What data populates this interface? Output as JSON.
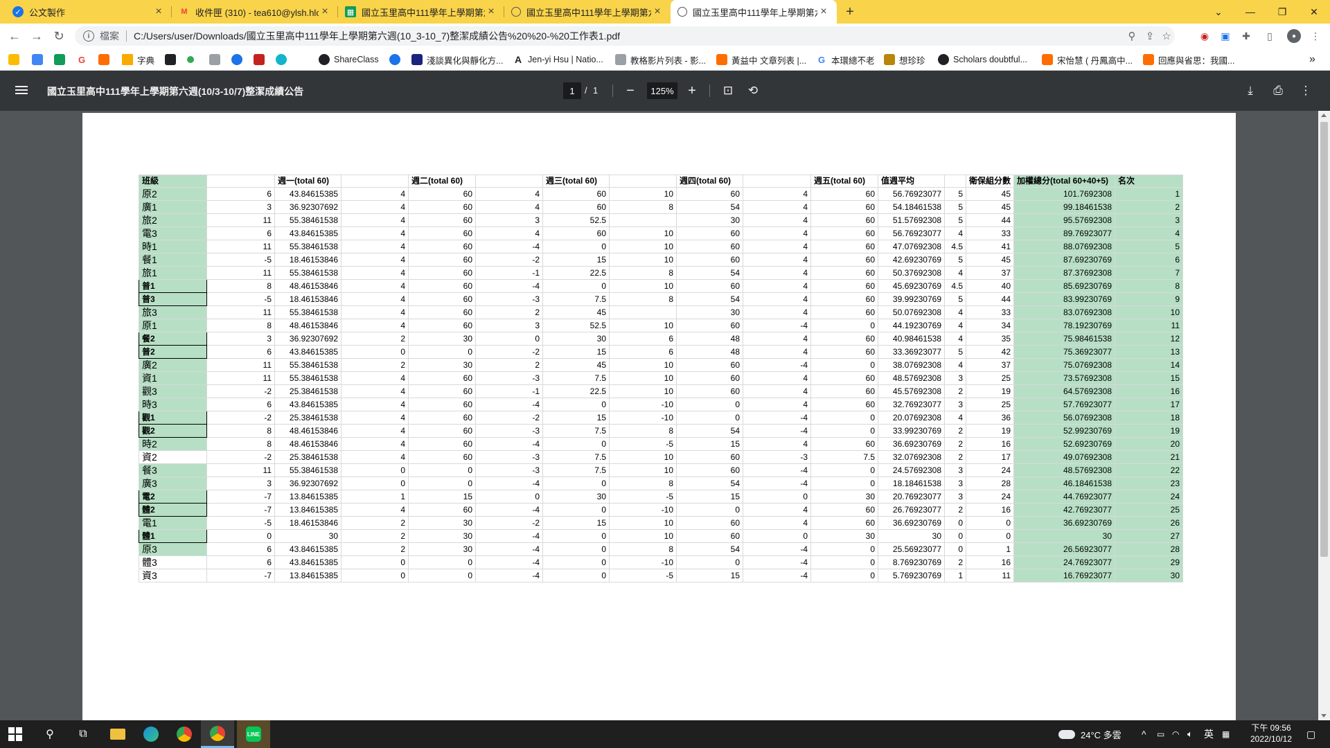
{
  "browser": {
    "tabs": [
      {
        "title": "公文製作",
        "icon": "gov-icon",
        "active": false
      },
      {
        "title": "收件匣 (310) - tea610@ylsh.hlc",
        "icon": "gmail-icon",
        "active": false
      },
      {
        "title": "國立玉里高中111學年上學期第六",
        "icon": "sheets-icon",
        "active": false
      },
      {
        "title": "國立玉里高中111學年上學期第六",
        "icon": "globe-icon",
        "active": false
      },
      {
        "title": "國立玉里高中111學年上學期第六",
        "icon": "globe-icon",
        "active": true
      }
    ],
    "new_tab": "+",
    "window_controls": {
      "menu": "⌄",
      "minimize": "—",
      "restore": "❐",
      "close": "✕"
    },
    "address": {
      "scheme_label": "檔案",
      "url": "C:/Users/user/Downloads/國立玉里高中111學年上學期第六週(10_3-10_7)整潔成績公告%20%20-%20工作表1.pdf"
    },
    "bookmarks": [
      {
        "label": "",
        "icon": "drive-icon",
        "color": "#fbbc04"
      },
      {
        "label": "",
        "icon": "bookmark-icon-2",
        "color": "#4285f4"
      },
      {
        "label": "",
        "icon": "bookmark-icon-3",
        "color": "#0f9d58"
      },
      {
        "label": "",
        "icon": "google-icon",
        "color": "#ea4335"
      },
      {
        "label": "",
        "icon": "bookmark-icon-5",
        "color": "#ff6d00"
      },
      {
        "label": "字典",
        "icon": "folder-icon",
        "color": "#f9ab00"
      },
      {
        "label": "",
        "icon": "bookmark-icon-7",
        "color": "#202124"
      },
      {
        "label": "",
        "icon": "bookmark-icon-8",
        "color": "#34a853"
      },
      {
        "label": "",
        "icon": "bookmark-icon-9",
        "color": "#9aa0a6"
      },
      {
        "label": "",
        "icon": "bookmark-icon-10",
        "color": "#1a73e8"
      },
      {
        "label": "",
        "icon": "bookmark-icon-11",
        "color": "#c5221f"
      },
      {
        "label": "",
        "icon": "bookmark-icon-12",
        "color": "#12b5cb"
      },
      {
        "label": "ShareClass",
        "icon": "shareclass-icon",
        "color": "#202124"
      },
      {
        "label": "",
        "icon": "bookmark-icon-14",
        "color": "#1a73e8"
      },
      {
        "label": "淺談異化與靜化方...",
        "icon": "bookmark-icon-15",
        "color": "#1a237e"
      },
      {
        "label": "Jen-yi Hsu | Natio...",
        "icon": "academia-icon",
        "color": "#202124"
      },
      {
        "label": "教格影片列表 - 影...",
        "icon": "bookmark-icon-17",
        "color": "#5f6368"
      },
      {
        "label": "黃益中 文章列表 |...",
        "icon": "bookmark-icon-18",
        "color": "#ff6d00"
      },
      {
        "label": "本環總不老",
        "icon": "google-icon",
        "color": "#4285f4"
      },
      {
        "label": "想珍珍",
        "icon": "bookmark-icon-20",
        "color": "#b8860b"
      },
      {
        "label": "Scholars doubtful...",
        "icon": "bookmark-icon-21",
        "color": "#202124"
      },
      {
        "label": "宋怡慧 ( 丹鳳高中...",
        "icon": "bookmark-icon-22",
        "color": "#ff6d00"
      },
      {
        "label": "回應與省思：我國...",
        "icon": "bookmark-icon-23",
        "color": "#ff6d00"
      }
    ],
    "more_bookmarks": "»"
  },
  "pdf": {
    "title": "國立玉里高中111學年上學期第六週(10/3-10/7)整潔成績公告",
    "page_current": "1",
    "page_sep": "/",
    "page_total": "1",
    "zoom": "125%",
    "zoom_out": "−",
    "zoom_in": "+"
  },
  "table": {
    "headers": [
      "班級",
      "",
      "週一(total 60)",
      "",
      "週二(total 60)",
      "",
      "週三(total 60)",
      "",
      "週四(total 60)",
      "",
      "週五(total 60)",
      "值週平均",
      "",
      "衛保組分數",
      "加權總分(total 60+40+5)",
      "名次"
    ],
    "rows": [
      {
        "cls": "原2",
        "style": "",
        "v": [
          "6",
          "43.84615385",
          "4",
          "60",
          "4",
          "60",
          "10",
          "60",
          "4",
          "60",
          "56.76923077",
          "5",
          "45",
          "101.7692308",
          "1"
        ]
      },
      {
        "cls": "廣1",
        "style": "",
        "v": [
          "3",
          "36.92307692",
          "4",
          "60",
          "4",
          "60",
          "8",
          "54",
          "4",
          "60",
          "54.18461538",
          "5",
          "45",
          "99.18461538",
          "2"
        ]
      },
      {
        "cls": "旅2",
        "style": "",
        "v": [
          "11",
          "55.38461538",
          "4",
          "60",
          "3",
          "52.5",
          "",
          "30",
          "4",
          "60",
          "51.57692308",
          "5",
          "44",
          "95.57692308",
          "3"
        ]
      },
      {
        "cls": "電3",
        "style": "",
        "v": [
          "6",
          "43.84615385",
          "4",
          "60",
          "4",
          "60",
          "10",
          "60",
          "4",
          "60",
          "56.76923077",
          "4",
          "33",
          "89.76923077",
          "4"
        ]
      },
      {
        "cls": "時1",
        "style": "",
        "v": [
          "11",
          "55.38461538",
          "4",
          "60",
          "-4",
          "0",
          "10",
          "60",
          "4",
          "60",
          "47.07692308",
          "4.5",
          "41",
          "88.07692308",
          "5"
        ]
      },
      {
        "cls": "餐1",
        "style": "",
        "v": [
          "-5",
          "18.46153846",
          "4",
          "60",
          "-2",
          "15",
          "10",
          "60",
          "4",
          "60",
          "42.69230769",
          "5",
          "45",
          "87.69230769",
          "6"
        ]
      },
      {
        "cls": "旅1",
        "style": "",
        "v": [
          "11",
          "55.38461538",
          "4",
          "60",
          "-1",
          "22.5",
          "8",
          "54",
          "4",
          "60",
          "50.37692308",
          "4",
          "37",
          "87.37692308",
          "7"
        ]
      },
      {
        "cls": "普1",
        "style": "boxed",
        "v": [
          "8",
          "48.46153846",
          "4",
          "60",
          "-4",
          "0",
          "10",
          "60",
          "4",
          "60",
          "45.69230769",
          "4.5",
          "40",
          "85.69230769",
          "8"
        ]
      },
      {
        "cls": "普3",
        "style": "boxed",
        "v": [
          "-5",
          "18.46153846",
          "4",
          "60",
          "-3",
          "7.5",
          "8",
          "54",
          "4",
          "60",
          "39.99230769",
          "5",
          "44",
          "83.99230769",
          "9"
        ]
      },
      {
        "cls": "旅3",
        "style": "",
        "v": [
          "11",
          "55.38461538",
          "4",
          "60",
          "2",
          "45",
          "",
          "30",
          "4",
          "60",
          "50.07692308",
          "4",
          "33",
          "83.07692308",
          "10"
        ]
      },
      {
        "cls": "原1",
        "style": "",
        "v": [
          "8",
          "48.46153846",
          "4",
          "60",
          "3",
          "52.5",
          "10",
          "60",
          "-4",
          "0",
          "44.19230769",
          "4",
          "34",
          "78.19230769",
          "11"
        ]
      },
      {
        "cls": "餐2",
        "style": "boxed",
        "v": [
          "3",
          "36.92307692",
          "2",
          "30",
          "0",
          "30",
          "6",
          "48",
          "4",
          "60",
          "40.98461538",
          "4",
          "35",
          "75.98461538",
          "12"
        ]
      },
      {
        "cls": "普2",
        "style": "boxed",
        "v": [
          "6",
          "43.84615385",
          "0",
          "0",
          "-2",
          "15",
          "6",
          "48",
          "4",
          "60",
          "33.36923077",
          "5",
          "42",
          "75.36923077",
          "13"
        ]
      },
      {
        "cls": "廣2",
        "style": "",
        "v": [
          "11",
          "55.38461538",
          "2",
          "30",
          "2",
          "45",
          "10",
          "60",
          "-4",
          "0",
          "38.07692308",
          "4",
          "37",
          "75.07692308",
          "14"
        ]
      },
      {
        "cls": "資1",
        "style": "",
        "v": [
          "11",
          "55.38461538",
          "4",
          "60",
          "-3",
          "7.5",
          "10",
          "60",
          "4",
          "60",
          "48.57692308",
          "3",
          "25",
          "73.57692308",
          "15"
        ]
      },
      {
        "cls": "觀3",
        "style": "",
        "v": [
          "-2",
          "25.38461538",
          "4",
          "60",
          "-1",
          "22.5",
          "10",
          "60",
          "4",
          "60",
          "45.57692308",
          "2",
          "19",
          "64.57692308",
          "16"
        ]
      },
      {
        "cls": "時3",
        "style": "",
        "v": [
          "6",
          "43.84615385",
          "4",
          "60",
          "-4",
          "0",
          "-10",
          "0",
          "4",
          "60",
          "32.76923077",
          "3",
          "25",
          "57.76923077",
          "17"
        ]
      },
      {
        "cls": "觀1",
        "style": "boxed",
        "v": [
          "-2",
          "25.38461538",
          "4",
          "60",
          "-2",
          "15",
          "-10",
          "0",
          "-4",
          "0",
          "20.07692308",
          "4",
          "36",
          "56.07692308",
          "18"
        ]
      },
      {
        "cls": "觀2",
        "style": "boxed",
        "v": [
          "8",
          "48.46153846",
          "4",
          "60",
          "-3",
          "7.5",
          "8",
          "54",
          "-4",
          "0",
          "33.99230769",
          "2",
          "19",
          "52.99230769",
          "19"
        ]
      },
      {
        "cls": "時2",
        "style": "",
        "v": [
          "8",
          "48.46153846",
          "4",
          "60",
          "-4",
          "0",
          "-5",
          "15",
          "4",
          "60",
          "36.69230769",
          "2",
          "16",
          "52.69230769",
          "20"
        ]
      },
      {
        "cls": "資2",
        "style": "plain",
        "v": [
          "-2",
          "25.38461538",
          "4",
          "60",
          "-3",
          "7.5",
          "10",
          "60",
          "-3",
          "7.5",
          "32.07692308",
          "2",
          "17",
          "49.07692308",
          "21"
        ]
      },
      {
        "cls": "餐3",
        "style": "",
        "v": [
          "11",
          "55.38461538",
          "0",
          "0",
          "-3",
          "7.5",
          "10",
          "60",
          "-4",
          "0",
          "24.57692308",
          "3",
          "24",
          "48.57692308",
          "22"
        ]
      },
      {
        "cls": "廣3",
        "style": "",
        "v": [
          "3",
          "36.92307692",
          "0",
          "0",
          "-4",
          "0",
          "8",
          "54",
          "-4",
          "0",
          "18.18461538",
          "3",
          "28",
          "46.18461538",
          "23"
        ]
      },
      {
        "cls": "電2",
        "style": "boxed",
        "v": [
          "-7",
          "13.84615385",
          "1",
          "15",
          "0",
          "30",
          "-5",
          "15",
          "0",
          "30",
          "20.76923077",
          "3",
          "24",
          "44.76923077",
          "24"
        ]
      },
      {
        "cls": "體2",
        "style": "boxed",
        "v": [
          "-7",
          "13.84615385",
          "4",
          "60",
          "-4",
          "0",
          "-10",
          "0",
          "4",
          "60",
          "26.76923077",
          "2",
          "16",
          "42.76923077",
          "25"
        ]
      },
      {
        "cls": "電1",
        "style": "",
        "v": [
          "-5",
          "18.46153846",
          "2",
          "30",
          "-2",
          "15",
          "10",
          "60",
          "4",
          "60",
          "36.69230769",
          "0",
          "0",
          "36.69230769",
          "26"
        ]
      },
      {
        "cls": "體1",
        "style": "boxed",
        "v": [
          "0",
          "30",
          "2",
          "30",
          "-4",
          "0",
          "10",
          "60",
          "0",
          "30",
          "30",
          "0",
          "0",
          "30",
          "27"
        ]
      },
      {
        "cls": "原3",
        "style": "",
        "v": [
          "6",
          "43.84615385",
          "2",
          "30",
          "-4",
          "0",
          "8",
          "54",
          "-4",
          "0",
          "25.56923077",
          "0",
          "1",
          "26.56923077",
          "28"
        ]
      },
      {
        "cls": "體3",
        "style": "plain",
        "v": [
          "6",
          "43.84615385",
          "0",
          "0",
          "-4",
          "0",
          "-10",
          "0",
          "-4",
          "0",
          "8.769230769",
          "2",
          "16",
          "24.76923077",
          "29"
        ]
      },
      {
        "cls": "資3",
        "style": "plain",
        "v": [
          "-7",
          "13.84615385",
          "0",
          "0",
          "-4",
          "0",
          "-5",
          "15",
          "-4",
          "0",
          "5.769230769",
          "1",
          "11",
          "16.76923077",
          "30"
        ]
      }
    ]
  },
  "taskbar": {
    "weather": "24°C 多雲",
    "ime": "英",
    "clock_time": "下午 09:56",
    "clock_date": "2022/10/12"
  }
}
